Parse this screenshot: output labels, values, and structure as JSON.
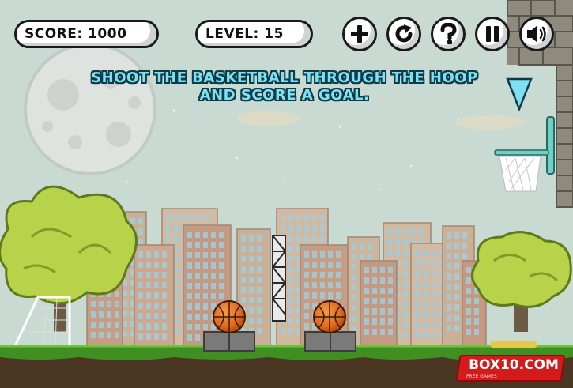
{
  "hud": {
    "score_label": "SCORE: 1000",
    "level_label": "LEVEL: 15"
  },
  "buttons": [
    {
      "name": "more-games-button",
      "icon": "plus-icon"
    },
    {
      "name": "restart-button",
      "icon": "restart-icon"
    },
    {
      "name": "help-button",
      "icon": "question-icon"
    },
    {
      "name": "pause-button",
      "icon": "pause-icon"
    },
    {
      "name": "sound-button",
      "icon": "speaker-icon"
    }
  ],
  "instructions": {
    "line1": "SHOOT THE BASKETBALL THROUGH THE HOOP",
    "line2": "AND SCORE A GOAL."
  },
  "logo": {
    "text": "BOX10.COM",
    "subtext": "FREE GAMES"
  },
  "colors": {
    "sky": "#c9dad3",
    "grass": "#3f8f22",
    "soil": "#4a3623",
    "ball": "#e06a1a",
    "instruction_text": "#7fe0f0",
    "logo_red": "#d31b1b"
  }
}
